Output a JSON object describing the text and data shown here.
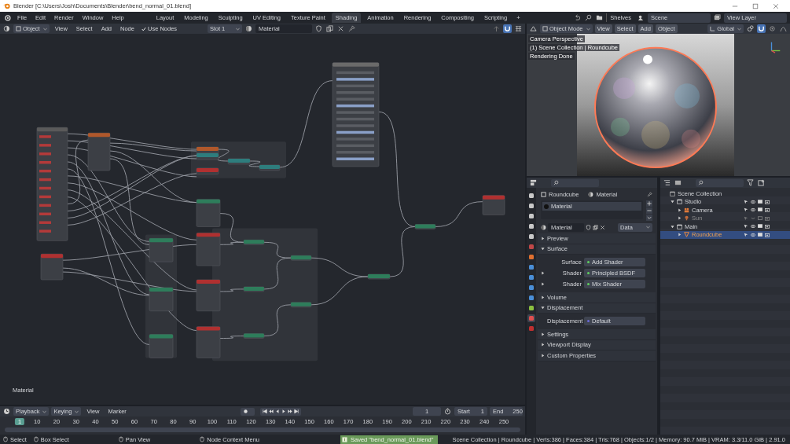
{
  "window": {
    "title": "Blender [C:\\Users\\Josh\\Documents\\Blender\\bend_normal_01.blend]"
  },
  "menu": [
    "File",
    "Edit",
    "Render",
    "Window",
    "Help"
  ],
  "workspaces": [
    {
      "label": "Layout",
      "selected": false
    },
    {
      "label": "Modeling",
      "selected": false
    },
    {
      "label": "Sculpting",
      "selected": false
    },
    {
      "label": "UV Editing",
      "selected": false
    },
    {
      "label": "Texture Paint",
      "selected": false
    },
    {
      "label": "Shading",
      "selected": true
    },
    {
      "label": "Animation",
      "selected": false
    },
    {
      "label": "Rendering",
      "selected": false
    },
    {
      "label": "Compositing",
      "selected": false
    },
    {
      "label": "Scripting",
      "selected": false
    }
  ],
  "add_workspace": "+",
  "topbar": {
    "shelves": "Shelves",
    "scene": "Scene",
    "view_layer": "View Layer"
  },
  "node_editor": {
    "mode": "Object",
    "menus": [
      "View",
      "Select",
      "Add",
      "Node"
    ],
    "use_nodes": {
      "label": "Use Nodes",
      "checked": true
    },
    "slot": "Slot 1",
    "material": "Material",
    "footer": "Material"
  },
  "viewport": {
    "mode": "Object Mode",
    "menus": [
      "View",
      "Select",
      "Add",
      "Object"
    ],
    "orientation": "Global",
    "overlay": [
      "Camera Perspective",
      "(1) Scene Collection | Roundcube",
      "Rendering Done"
    ]
  },
  "properties": {
    "tabs": [
      {
        "color": "#c8c8c8",
        "selected": false
      },
      {
        "color": "#c8c8c8",
        "selected": false
      },
      {
        "color": "#c8c8c8",
        "selected": false
      },
      {
        "color": "#c8c8c8",
        "selected": false
      },
      {
        "color": "#c8c8c8",
        "selected": false
      },
      {
        "color": "#c04848",
        "selected": false
      },
      {
        "color": "#e07030",
        "selected": false
      },
      {
        "color": "#4a8fd8",
        "selected": false
      },
      {
        "color": "#4a8fd8",
        "selected": false
      },
      {
        "color": "#4a8fd8",
        "selected": false
      },
      {
        "color": "#4a8fd8",
        "selected": false
      },
      {
        "color": "#8cc040",
        "selected": false
      },
      {
        "color": "#e05050",
        "selected": true
      },
      {
        "color": "#c03030",
        "selected": false
      }
    ],
    "breadcrumb": [
      "Roundcube",
      "Material"
    ],
    "slots": [
      {
        "name": "Material",
        "selected": true
      }
    ],
    "material": "Material",
    "link": "Data",
    "panels": [
      {
        "label": "Preview",
        "expanded": false
      },
      {
        "label": "Surface",
        "expanded": true,
        "fields": [
          {
            "label": "Surface",
            "value": "Add Shader",
            "color": "#5fd05f"
          },
          {
            "label": "Shader",
            "value": "Principled BSDF",
            "color": "#5fd05f",
            "expanded": false
          },
          {
            "label": "Shader",
            "value": "Mix Shader",
            "color": "#5fd05f",
            "expanded": false
          }
        ]
      },
      {
        "label": "Volume",
        "expanded": false
      },
      {
        "label": "Displacement",
        "expanded": true,
        "fields": [
          {
            "label": "Displacement",
            "value": "Default",
            "color": "#6a6ad8"
          }
        ]
      },
      {
        "label": "Settings",
        "expanded": false
      },
      {
        "label": "Viewport Display",
        "expanded": false
      },
      {
        "label": "Custom Properties",
        "expanded": false
      }
    ]
  },
  "outliner": {
    "tree": [
      {
        "label": "Scene Collection",
        "kind": "scene",
        "selected": false,
        "disabled": false,
        "children": [
          {
            "label": "Studio",
            "kind": "collection",
            "expanded": true,
            "selected": false,
            "disabled": false,
            "children": [
              {
                "label": "Camera",
                "kind": "camera",
                "expanded": false,
                "selected": false,
                "disabled": false
              },
              {
                "label": "Sun",
                "kind": "light",
                "expanded": false,
                "selected": false,
                "disabled": true
              }
            ]
          },
          {
            "label": "Main",
            "kind": "collection",
            "expanded": true,
            "selected": false,
            "disabled": false,
            "children": [
              {
                "label": "Roundcube",
                "kind": "mesh",
                "expanded": false,
                "selected": true,
                "disabled": false
              }
            ]
          }
        ]
      }
    ]
  },
  "timeline": {
    "menus": [
      "Playback",
      "Keying",
      "View",
      "Marker"
    ],
    "current_frame": "1",
    "start_label": "Start",
    "start": "1",
    "end_label": "End",
    "end": "250",
    "ruler": [
      {
        "label": "1",
        "selected": true
      },
      {
        "label": "10",
        "selected": false
      },
      {
        "label": "20",
        "selected": false
      },
      {
        "label": "30",
        "selected": false
      },
      {
        "label": "40",
        "selected": false
      },
      {
        "label": "50",
        "selected": false
      },
      {
        "label": "60",
        "selected": false
      },
      {
        "label": "70",
        "selected": false
      },
      {
        "label": "80",
        "selected": false
      },
      {
        "label": "90",
        "selected": false
      },
      {
        "label": "100",
        "selected": false
      },
      {
        "label": "110",
        "selected": false
      },
      {
        "label": "120",
        "selected": false
      },
      {
        "label": "130",
        "selected": false
      },
      {
        "label": "140",
        "selected": false
      },
      {
        "label": "150",
        "selected": false
      },
      {
        "label": "160",
        "selected": false
      },
      {
        "label": "170",
        "selected": false
      },
      {
        "label": "180",
        "selected": false
      },
      {
        "label": "190",
        "selected": false
      },
      {
        "label": "200",
        "selected": false
      },
      {
        "label": "210",
        "selected": false
      },
      {
        "label": "220",
        "selected": false
      },
      {
        "label": "230",
        "selected": false
      },
      {
        "label": "240",
        "selected": false
      },
      {
        "label": "250",
        "selected": false
      }
    ]
  },
  "status_bar": {
    "hints": [
      "Select",
      "Box Select",
      "Pan View",
      "Node Context Menu"
    ],
    "message": "Saved \"bend_normal_01.blend\"",
    "stats": "Scene Collection | Roundcube | Verts:386 | Faces:384 | Tris:768 | Objects:1/2 | Memory: 90.7 MiB | VRAM: 3.3/11.0 GiB | 2.91.0"
  }
}
